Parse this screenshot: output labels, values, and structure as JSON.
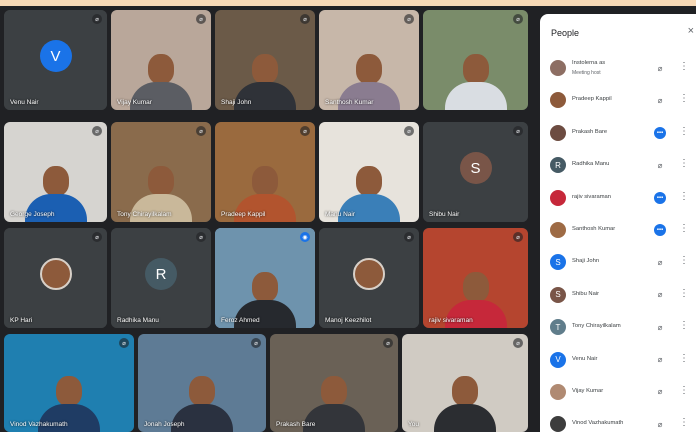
{
  "window": {
    "accent": "#f7d9b6",
    "background": "#202124"
  },
  "grid": {
    "rows": [
      [
        {
          "name": "Venu Nair",
          "avatar_letter": "V",
          "avatar_color": "#1a73e8",
          "video": false,
          "scene": "#3c4043",
          "shirt": "#3c4043"
        },
        {
          "name": "Vijay Kumar",
          "video": true,
          "scene": "#b9a79a",
          "shirt": "#5b5d63"
        },
        {
          "name": "Shaji John",
          "video": true,
          "scene": "#6b5a48",
          "shirt": "#2f3238"
        },
        {
          "name": "Santhosh Kumar",
          "video": true,
          "scene": "#c7b7a9",
          "shirt": "#8a7c90"
        },
        {
          "name": "",
          "video": true,
          "scene": "#7a8c6a",
          "shirt": "#d9dde2"
        }
      ],
      [
        {
          "name": "George Joseph",
          "video": true,
          "scene": "#d6d4d0",
          "shirt": "#1b5fb2"
        },
        {
          "name": "Tony Chirayilkalam",
          "video": true,
          "scene": "#8a6b4c",
          "shirt": "#c9b89a"
        },
        {
          "name": "Pradeep Kappil",
          "video": true,
          "scene": "#9a6a3e",
          "shirt": "#b2542e"
        },
        {
          "name": "Manu Nair",
          "video": true,
          "scene": "#e7e3dc",
          "shirt": "#3a7fb8"
        },
        {
          "name": "Shibu Nair",
          "avatar_letter": "S",
          "avatar_color": "#795548",
          "video": false,
          "scene": "#3c4043",
          "shirt": "#3c4043"
        }
      ],
      [
        {
          "name": "KP Hari",
          "video": true,
          "scene": "#3c4043",
          "shirt": "#3c4043",
          "round": true
        },
        {
          "name": "Radhika Manu",
          "avatar_letter": "R",
          "avatar_color": "#455a64",
          "video": false,
          "scene": "#3c4043",
          "shirt": "#3c4043"
        },
        {
          "name": "Feroz Ahmed",
          "video": true,
          "scene": "#6e93ad",
          "shirt": "#26292e",
          "speaking": true
        },
        {
          "name": "Manoj Keezhilot",
          "video": true,
          "scene": "#3c4043",
          "shirt": "#3c4043",
          "round": true
        },
        {
          "name": "rajiv sivaraman",
          "video": true,
          "scene": "#b5452f",
          "shirt": "#c6283a"
        }
      ],
      [
        {
          "name": "Vinod Vazhakumath",
          "video": true,
          "scene": "#1f7fb0",
          "shirt": "#1f3c64"
        },
        {
          "name": "Jonah Joseph",
          "video": true,
          "scene": "#5e7b95",
          "shirt": "#2a3140"
        },
        {
          "name": "Prakash Bare",
          "video": true,
          "scene": "#6a6156",
          "shirt": "#33353a"
        },
        {
          "name": "You",
          "video": true,
          "scene": "#d0cbc3",
          "shirt": "#2b2d31"
        }
      ]
    ]
  },
  "panel": {
    "title": "People",
    "close_icon": "×",
    "participants": [
      {
        "name": "Instolerna as",
        "sub": "Meeting host",
        "avatar_color": "#8d6e63",
        "photo": true,
        "mic_active": false
      },
      {
        "name": "Pradeep Kappil",
        "avatar_color": "#8d5a3b",
        "photo": true,
        "mic_active": false
      },
      {
        "name": "Prakash Bare",
        "avatar_color": "#6d4c41",
        "photo": true,
        "mic_active": true
      },
      {
        "name": "Radhika Manu",
        "avatar_letter": "R",
        "avatar_color": "#455a64",
        "photo": false,
        "mic_active": false
      },
      {
        "name": "rajiv sivaraman",
        "avatar_color": "#c6283a",
        "photo": true,
        "mic_active": true
      },
      {
        "name": "Santhosh Kumar",
        "avatar_color": "#9e6b45",
        "photo": true,
        "mic_active": true
      },
      {
        "name": "Shaji John",
        "avatar_letter": "S",
        "avatar_color": "#1a73e8",
        "photo": false,
        "mic_active": false
      },
      {
        "name": "Shibu Nair",
        "avatar_letter": "S",
        "avatar_color": "#795548",
        "photo": false,
        "mic_active": false
      },
      {
        "name": "Tony Chirayilkalam",
        "avatar_letter": "T",
        "avatar_color": "#607d8b",
        "photo": false,
        "mic_active": false
      },
      {
        "name": "Venu Nair",
        "avatar_letter": "V",
        "avatar_color": "#1a73e8",
        "photo": false,
        "mic_active": false
      },
      {
        "name": "Vijay Kumar",
        "avatar_color": "#b08a72",
        "photo": true,
        "mic_active": false
      },
      {
        "name": "Vinod Vazhakumath",
        "avatar_color": "#3d3d3d",
        "photo": true,
        "mic_active": false
      }
    ]
  },
  "icons": {
    "mic_off": "mic-off-icon",
    "mic_on": "mic-active-icon",
    "more": "more-vert-icon"
  }
}
